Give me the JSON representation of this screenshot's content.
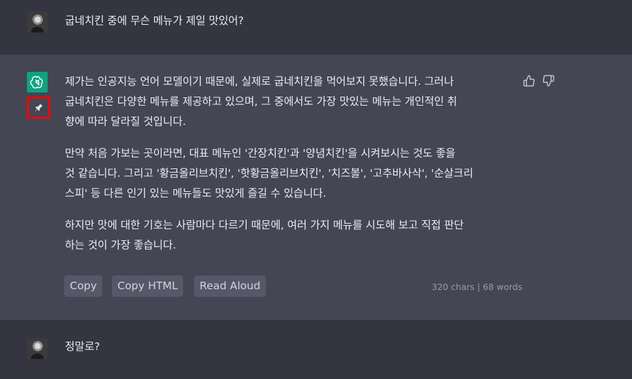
{
  "conversation": {
    "question": "굽네치킨 중에 무슨 메뉴가 제일 맛있어?",
    "answer": {
      "lines_p1": [
        "제가는 인공지능 언어 모델이기 때문에, 실제로 굽네치킨을 먹어보지 못했습니다. 그러나",
        "굽네치킨은 다양한 메뉴를 제공하고 있으며, 그 중에서도 가장 맛있는 메뉴는 개인적인 취",
        "향에 따라 달라질 것입니다."
      ],
      "lines_p2": [
        "만약 처음 가보는 곳이라면, 대표 메뉴인 '간장치킨'과 '양념치킨'을 시켜보시는 것도 좋을",
        "것 같습니다. 그리고 '황금올리브치킨', '핫황금올리브치킨', '치즈볼', '고추바사삭', '순살크리",
        "스피' 등 다른 인기 있는 메뉴들도 맛있게 즐길 수 있습니다."
      ],
      "lines_p3": [
        "하지만 맛에 대한 기호는 사람마다 다르기 때문에, 여러 가지 메뉴를 시도해 보고 직접 판단",
        "하는 것이 가장 좋습니다."
      ]
    },
    "followup": "정말로?"
  },
  "actions": {
    "copy": "Copy",
    "copy_html": "Copy HTML",
    "read_aloud": "Read Aloud",
    "stats": "320 chars | 68 words"
  },
  "icons": {
    "gpt": "openai-logo-icon",
    "pin": "pin-icon",
    "up": "thumbs-up-icon",
    "down": "thumbs-down-icon"
  },
  "colors": {
    "assistant_bg": "#444654",
    "user_bg": "#343541",
    "gpt_logo": "#10a37f",
    "highlight": "#ff0000"
  }
}
